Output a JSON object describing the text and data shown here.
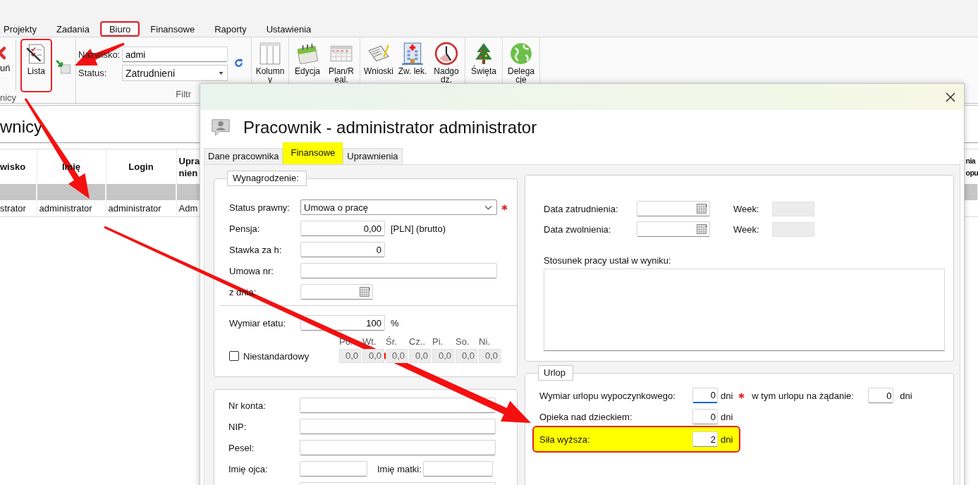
{
  "app": {
    "menu_tabs": [
      {
        "label": "Projekty",
        "selected": false,
        "highlighted": false
      },
      {
        "label": "Zadania",
        "selected": false,
        "highlighted": false
      },
      {
        "label": "Biuro",
        "selected": true,
        "highlighted": true
      },
      {
        "label": "Finansowe",
        "selected": false,
        "highlighted": false
      },
      {
        "label": "Raporty",
        "selected": false,
        "highlighted": false
      },
      {
        "label": "Ustawienia",
        "selected": false,
        "highlighted": false
      }
    ],
    "ribbon": {
      "employees_group": {
        "label": "nicy",
        "buttons": [
          {
            "kind": "delete",
            "label": "uń",
            "highlighted": false
          },
          {
            "kind": "list",
            "label": "Lista",
            "highlighted": true
          },
          {
            "kind": "export",
            "highlighted": false
          }
        ]
      },
      "filter": {
        "label": "Filtr",
        "fields": [
          {
            "kind": "text",
            "label": "Nazwisko:",
            "value": "admi"
          },
          {
            "kind": "select",
            "label": "Status:",
            "value": "Zatrudnieni"
          }
        ]
      },
      "groups": [
        {
          "buttons": [
            {
              "kind": "columns",
              "label": "Kolumny"
            }
          ]
        },
        {
          "buttons": [
            {
              "kind": "calendar",
              "label": "Edycja"
            },
            {
              "kind": "grid",
              "label": "Plan/Real."
            }
          ]
        },
        {
          "buttons": [
            {
              "kind": "document",
              "label": "Wnioski"
            },
            {
              "kind": "hospital",
              "label": "Zw. lek."
            },
            {
              "kind": "clock",
              "label": "Nadgodz."
            }
          ]
        },
        {
          "buttons": [
            {
              "kind": "tree",
              "label": "Święta"
            }
          ]
        },
        {
          "buttons": [
            {
              "kind": "globe",
              "label": "Delegacje"
            }
          ]
        }
      ]
    },
    "page_title": "wnicy",
    "table": {
      "columns": [
        "wisko",
        "Imię",
        "Login",
        "Upra\nnien",
        "nia\nopu"
      ],
      "rows": [
        [
          "strator",
          "administrator",
          "administrator",
          "Adm"
        ]
      ]
    }
  },
  "dialog": {
    "title": "Pracownik - administrator administrator",
    "tabs": [
      {
        "label": "Dane pracownika",
        "selected": false,
        "highlighted": false
      },
      {
        "label": "Finansowe",
        "selected": true,
        "highlighted": true
      },
      {
        "label": "Uprawnienia",
        "selected": false,
        "highlighted": false
      }
    ],
    "salary": {
      "legend": "Wynagrodzenie:",
      "rows": [
        {
          "kind": "select",
          "label": "Status prawny:",
          "value": "Umowa o pracę",
          "required": true
        },
        {
          "kind": "number",
          "label": "Pensja:",
          "value": "0,00",
          "suffix": "[PLN] (brutto)",
          "required": false
        },
        {
          "kind": "number",
          "label": "Stawka za h:",
          "value": "0",
          "required": false
        },
        {
          "kind": "text",
          "label": "Umowa nr:",
          "required": false
        },
        {
          "kind": "date",
          "label": "z dnia:",
          "required": false
        }
      ],
      "etat": {
        "label": "Wymiar etatu:",
        "value": "100",
        "suffix": "%"
      },
      "nonstandard": {
        "label": "Niestandardowy",
        "checked": false
      },
      "days": [
        {
          "label": "Po.",
          "value": "0,0",
          "disabled": true
        },
        {
          "label": "Wt.",
          "value": "0,0",
          "disabled": true
        },
        {
          "label": "Śr.",
          "value": "0,0",
          "disabled": true
        },
        {
          "label": "Cz..",
          "value": "0,0",
          "disabled": true
        },
        {
          "label": "Pi.",
          "value": "0,0",
          "disabled": true
        },
        {
          "label": "So.",
          "value": "0,0",
          "disabled": true
        },
        {
          "label": "Ni.",
          "value": "0,0",
          "disabled": true
        }
      ]
    },
    "personal": {
      "rows": [
        {
          "kind": "full",
          "label": "Nr konta:"
        },
        {
          "kind": "full",
          "label": "NIP:"
        },
        {
          "kind": "full",
          "label": "Pesel:"
        },
        {
          "kind": "pair",
          "label": "Imię ojca:",
          "label_2": "Imię matki:"
        },
        {
          "kind": "blank"
        }
      ]
    },
    "employment": {
      "dates": [
        {
          "label": "Data zatrudnienia:",
          "week_label": "Week:"
        },
        {
          "label": "Data zwolnienia:",
          "week_label": "Week:"
        }
      ],
      "reason_label": "Stosunek pracy ustał w wyniku:"
    },
    "leave": {
      "legend": "Urlop",
      "rows": [
        {
          "label": "Wymiar urlopu wypoczynkowego:",
          "value": "0",
          "unit": "dni",
          "required": true,
          "focused": true,
          "highlighted": false,
          "extra": {
            "label": "w tym urlopu na żądanie:",
            "value": "0",
            "unit": "dni"
          }
        },
        {
          "label": "Opieka nad dzieckiem:",
          "value": "0",
          "unit": "dni",
          "required": false,
          "focused": false,
          "highlighted": false
        },
        {
          "label": "Siła wyższa:",
          "value": "2",
          "unit": "dni",
          "required": false,
          "focused": false,
          "highlighted": true
        }
      ]
    }
  }
}
